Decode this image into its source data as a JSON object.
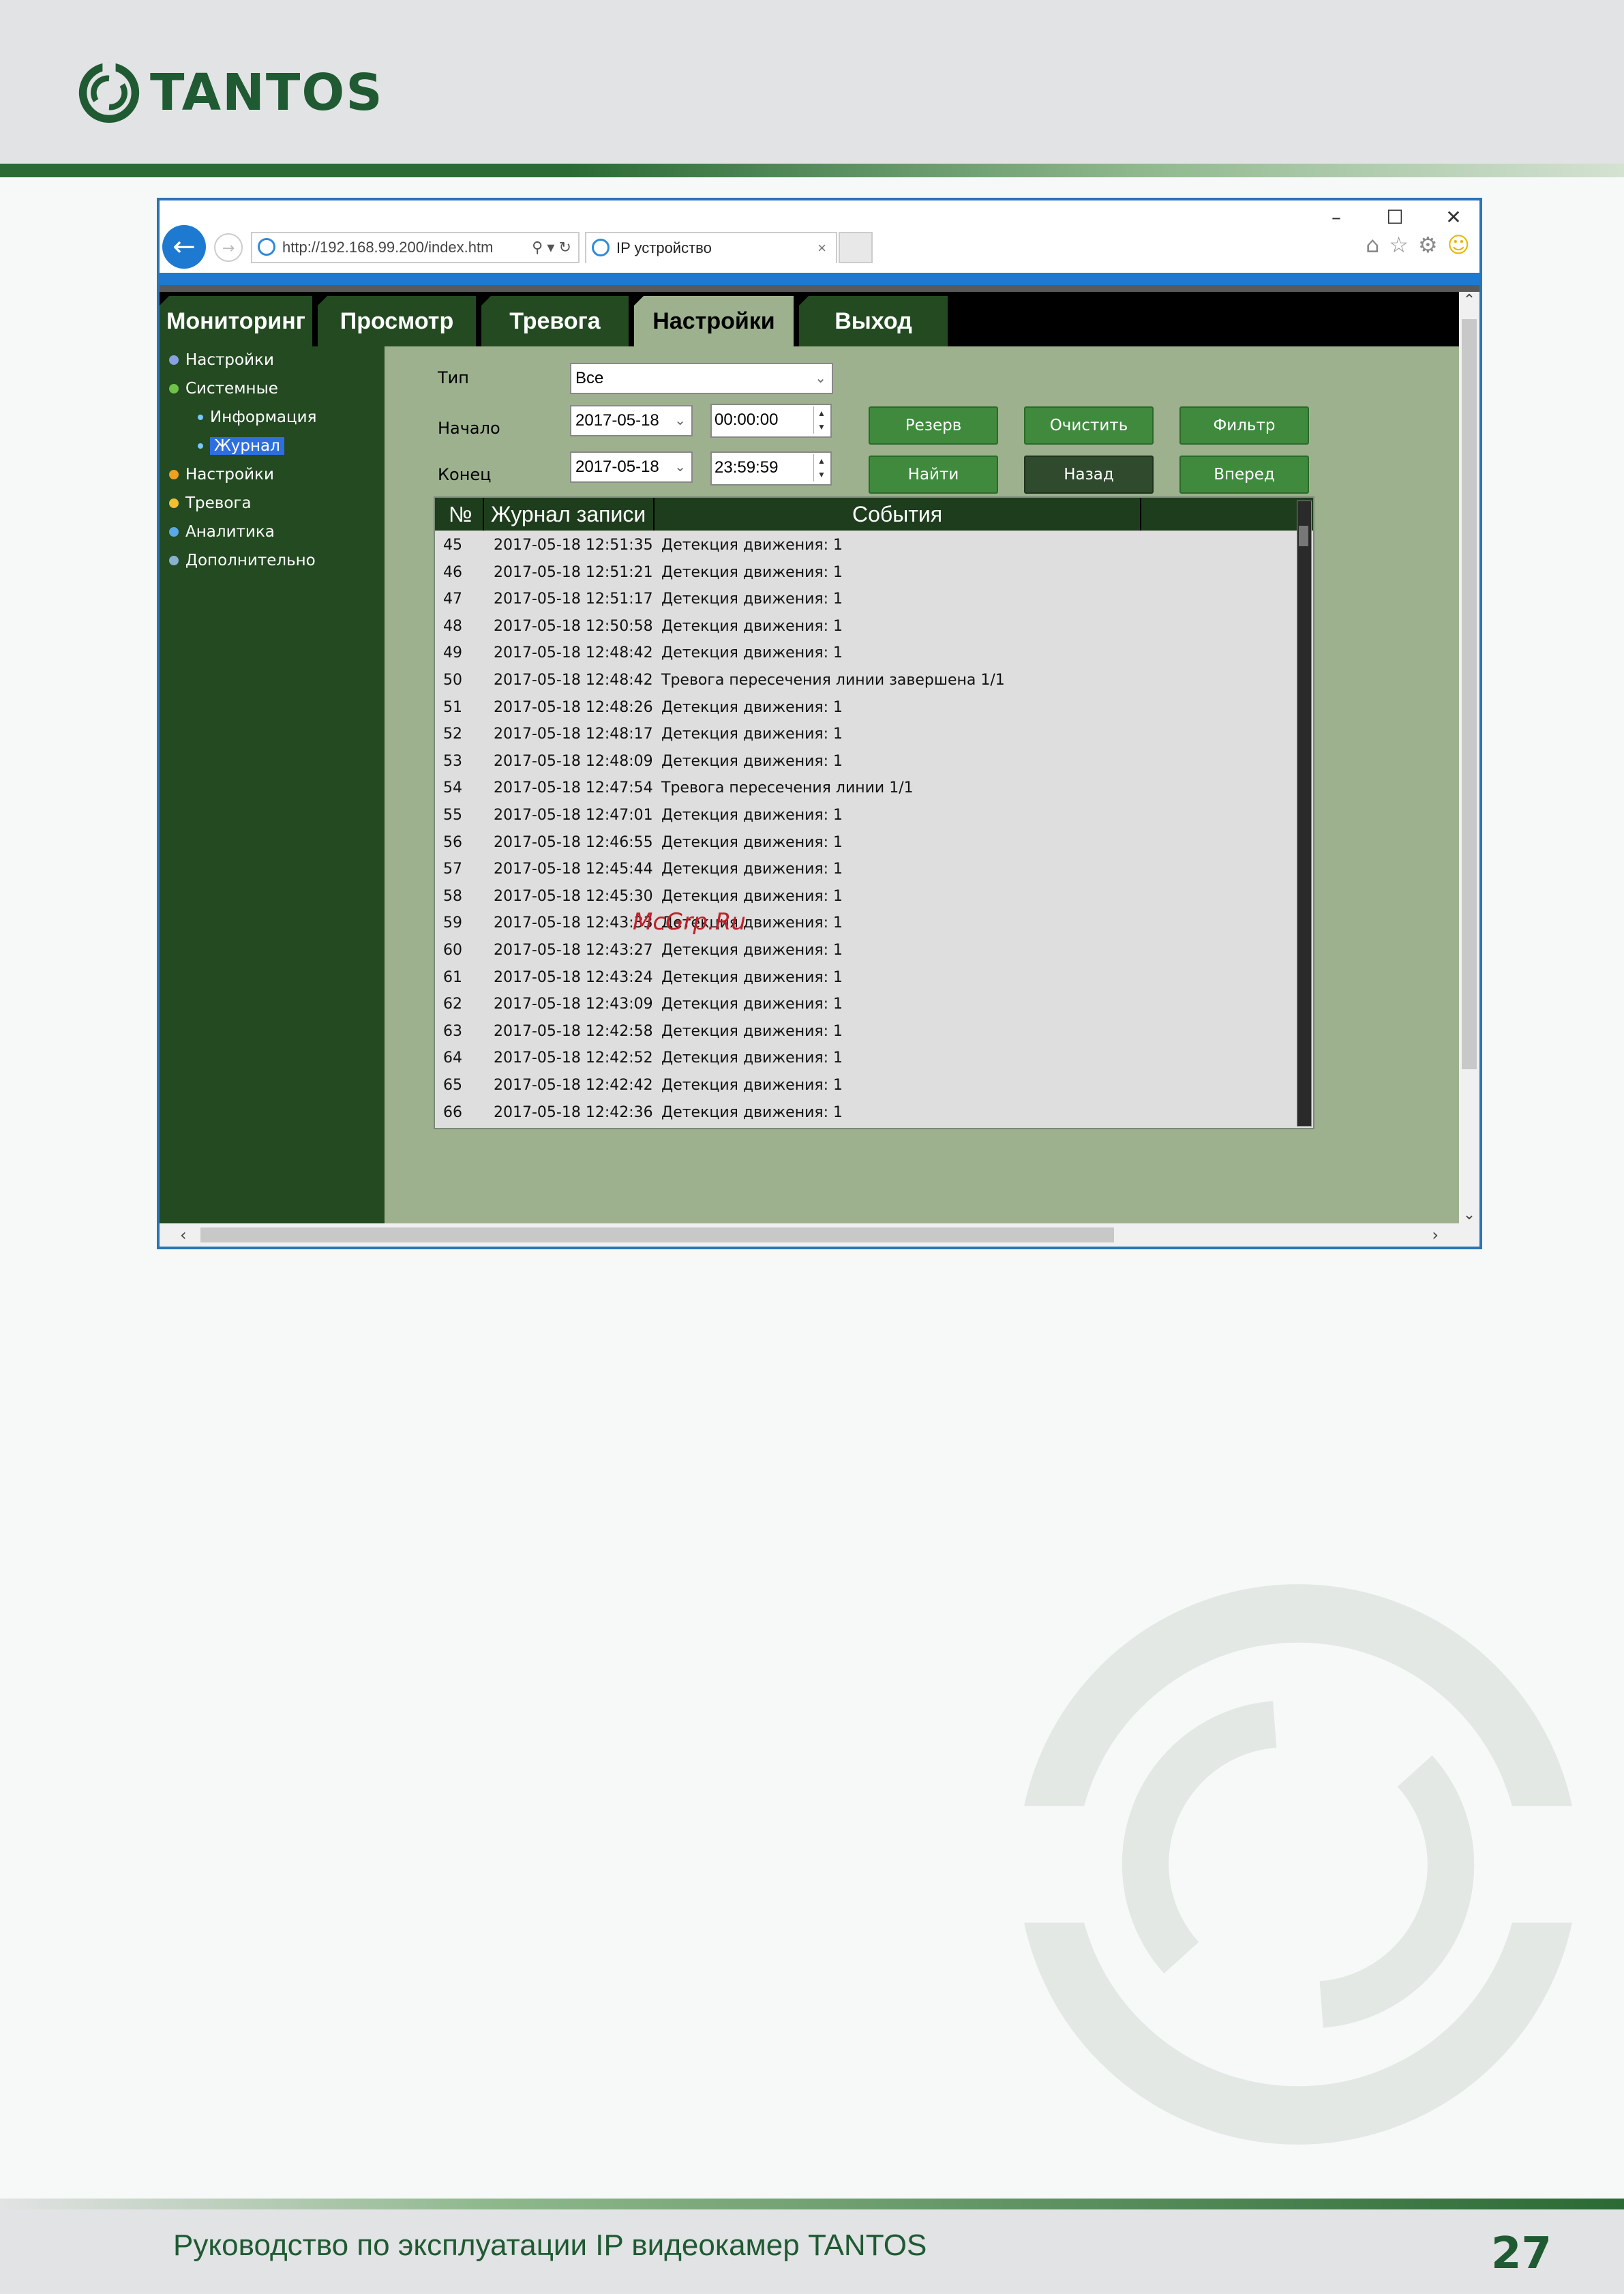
{
  "brand": {
    "logo_text": "TANTOS"
  },
  "browser": {
    "url": "http://192.168.99.200/index.htm",
    "tab_title": "IP устройство",
    "search_tools": "⚲ ▾ ↻",
    "window_controls": [
      "–",
      "☐",
      "✕"
    ]
  },
  "nav": {
    "tabs": [
      {
        "label": "Мониторинг"
      },
      {
        "label": "Просмотр"
      },
      {
        "label": "Тревога"
      },
      {
        "label": "Настройки"
      },
      {
        "label": "Выход"
      }
    ],
    "active_tab": "Настройки"
  },
  "sidebar": {
    "items": [
      {
        "label": "Настройки"
      },
      {
        "label": "Системные"
      },
      {
        "label": "Информация"
      },
      {
        "label": "Журнал"
      },
      {
        "label": "Настройки"
      },
      {
        "label": "Тревога"
      },
      {
        "label": "Аналитика"
      },
      {
        "label": "Дополнительно"
      }
    ],
    "selected": "Журнал"
  },
  "filters": {
    "type_label": "Тип",
    "type_value": "Все",
    "start_label": "Начало",
    "start_date": "2017-05-18",
    "start_time": "00:00:00",
    "end_label": "Конец",
    "end_date": "2017-05-18",
    "end_time": "23:59:59"
  },
  "buttons": {
    "backup": "Резерв",
    "clear": "Очистить",
    "filter": "Фильтр",
    "find": "Найти",
    "back": "Назад",
    "forward": "Вперед"
  },
  "log": {
    "headers": [
      "№",
      "Журнал записи",
      "События"
    ],
    "rows": [
      {
        "no": "45",
        "time": "2017-05-18 12:51:35",
        "event": "Детекция движения: 1"
      },
      {
        "no": "46",
        "time": "2017-05-18 12:51:21",
        "event": "Детекция движения: 1"
      },
      {
        "no": "47",
        "time": "2017-05-18 12:51:17",
        "event": "Детекция движения: 1"
      },
      {
        "no": "48",
        "time": "2017-05-18 12:50:58",
        "event": "Детекция движения: 1"
      },
      {
        "no": "49",
        "time": "2017-05-18 12:48:42",
        "event": "Детекция движения: 1"
      },
      {
        "no": "50",
        "time": "2017-05-18 12:48:42",
        "event": "Тревога пересечения линии завершена 1/1"
      },
      {
        "no": "51",
        "time": "2017-05-18 12:48:26",
        "event": "Детекция движения: 1"
      },
      {
        "no": "52",
        "time": "2017-05-18 12:48:17",
        "event": "Детекция движения: 1"
      },
      {
        "no": "53",
        "time": "2017-05-18 12:48:09",
        "event": "Детекция движения: 1"
      },
      {
        "no": "54",
        "time": "2017-05-18 12:47:54",
        "event": "Тревога пересечения линии 1/1"
      },
      {
        "no": "55",
        "time": "2017-05-18 12:47:01",
        "event": "Детекция движения: 1"
      },
      {
        "no": "56",
        "time": "2017-05-18 12:46:55",
        "event": "Детекция движения: 1"
      },
      {
        "no": "57",
        "time": "2017-05-18 12:45:44",
        "event": "Детекция движения: 1"
      },
      {
        "no": "58",
        "time": "2017-05-18 12:45:30",
        "event": "Детекция движения: 1"
      },
      {
        "no": "59",
        "time": "2017-05-18 12:43:33",
        "event": "Детекция движения: 1"
      },
      {
        "no": "60",
        "time": "2017-05-18 12:43:27",
        "event": "Детекция движения: 1"
      },
      {
        "no": "61",
        "time": "2017-05-18 12:43:24",
        "event": "Детекция движения: 1"
      },
      {
        "no": "62",
        "time": "2017-05-18 12:43:09",
        "event": "Детекция движения: 1"
      },
      {
        "no": "63",
        "time": "2017-05-18 12:42:58",
        "event": "Детекция движения: 1"
      },
      {
        "no": "64",
        "time": "2017-05-18 12:42:52",
        "event": "Детекция движения: 1"
      },
      {
        "no": "65",
        "time": "2017-05-18 12:42:42",
        "event": "Детекция движения: 1"
      },
      {
        "no": "66",
        "time": "2017-05-18 12:42:36",
        "event": "Детекция движения: 1"
      }
    ]
  },
  "watermark": "McGrp.Ru",
  "footer": {
    "title": "Руководство по эксплуатации IP видеокамер TANTOS",
    "page_number": "27"
  },
  "colors": {
    "brand_green": "#1f5a33",
    "app_bg": "#9db18f",
    "sidebar_bg": "#234a21",
    "button_green": "#3f8a3d",
    "browser_blue": "#1e7ad0"
  }
}
